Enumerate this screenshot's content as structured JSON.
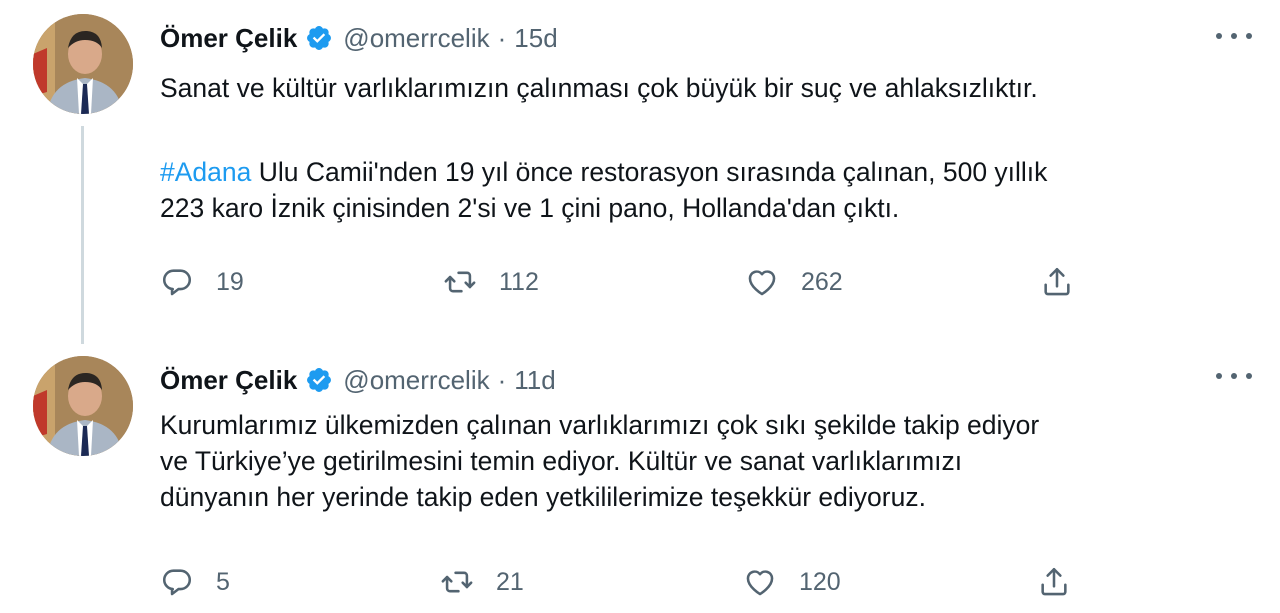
{
  "tweets": [
    {
      "author_name": "Ömer Çelik",
      "handle": "@omerrcelik",
      "separator": "·",
      "time": "15d",
      "paragraphs": [
        "Sanat ve kültür varlıklarımızın çalınması çok büyük bir suç ve ahlaksızlıktır."
      ],
      "hashtag": "#Adana",
      "paragraph2_line1": " Ulu Camii'nden 19 yıl önce restorasyon sırasında çalınan, 500 yıllık",
      "paragraph2_line2": "223 karo İznik çinisinden 2'si ve 1 çini pano, Hollanda'dan çıktı.",
      "replies": "19",
      "retweets": "112",
      "likes": "262"
    },
    {
      "author_name": "Ömer Çelik",
      "handle": "@omerrcelik",
      "separator": "·",
      "time": "11d",
      "line1": "Kurumlarımız ülkemizden çalınan varlıklarımızı çok sıkı şekilde takip ediyor",
      "line2": "ve Türkiye’ye getirilmesini temin ediyor. Kültür ve sanat varlıklarımızı",
      "line3": "dünyanın her yerinde takip eden yetkililerimize teşekkür ediyoruz.",
      "replies": "5",
      "retweets": "21",
      "likes": "120"
    }
  ],
  "icons": {
    "verified": "verified-badge-icon",
    "reply": "reply-icon",
    "retweet": "retweet-icon",
    "like": "heart-icon",
    "share": "share-icon",
    "more": "more-icon"
  },
  "colors": {
    "accent": "#1d9bf0",
    "text": "#0f1419",
    "secondary": "#536471",
    "thread_line": "#cfd9de"
  }
}
